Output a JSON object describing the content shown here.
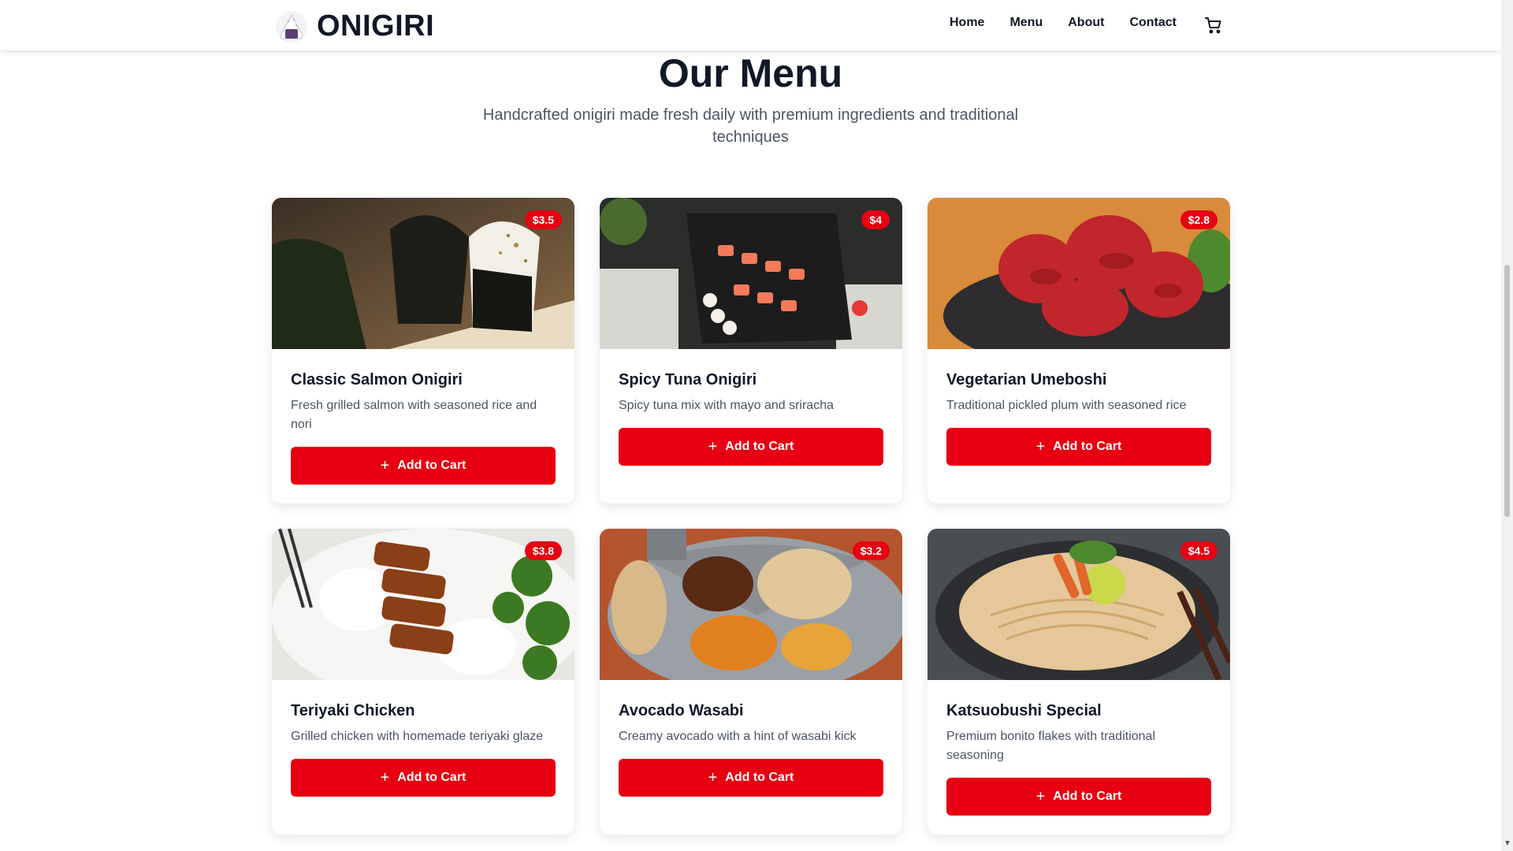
{
  "header": {
    "brand": "ONIGIRI",
    "nav": [
      "Home",
      "Menu",
      "About",
      "Contact"
    ]
  },
  "menu": {
    "title": "Our Menu",
    "subtitle": "Handcrafted onigiri made fresh daily with premium ingredients and traditional techniques"
  },
  "items": [
    {
      "name": "Classic Salmon Onigiri",
      "description": "Fresh grilled salmon with seasoned rice and nori",
      "price": "$3.5",
      "button": "Add to Cart"
    },
    {
      "name": "Spicy Tuna Onigiri",
      "description": "Spicy tuna mix with mayo and sriracha",
      "price": "$4",
      "button": "Add to Cart"
    },
    {
      "name": "Vegetarian Umeboshi",
      "description": "Traditional pickled plum with seasoned rice",
      "price": "$2.8",
      "button": "Add to Cart"
    },
    {
      "name": "Teriyaki Chicken",
      "description": "Grilled chicken with homemade teriyaki glaze",
      "price": "$3.8",
      "button": "Add to Cart"
    },
    {
      "name": "Avocado Wasabi",
      "description": "Creamy avocado with a hint of wasabi kick",
      "price": "$3.2",
      "button": "Add to Cart"
    },
    {
      "name": "Katsuobushi Special",
      "description": "Premium bonito flakes with traditional seasoning",
      "price": "$4.5",
      "button": "Add to Cart"
    }
  ],
  "icons": {
    "logo": "onigiri-logo-icon",
    "cart": "shopping-cart-icon",
    "plus": "plus-icon"
  },
  "colors": {
    "accent": "#e60012",
    "text": "#111827",
    "muted": "#4b5563"
  }
}
